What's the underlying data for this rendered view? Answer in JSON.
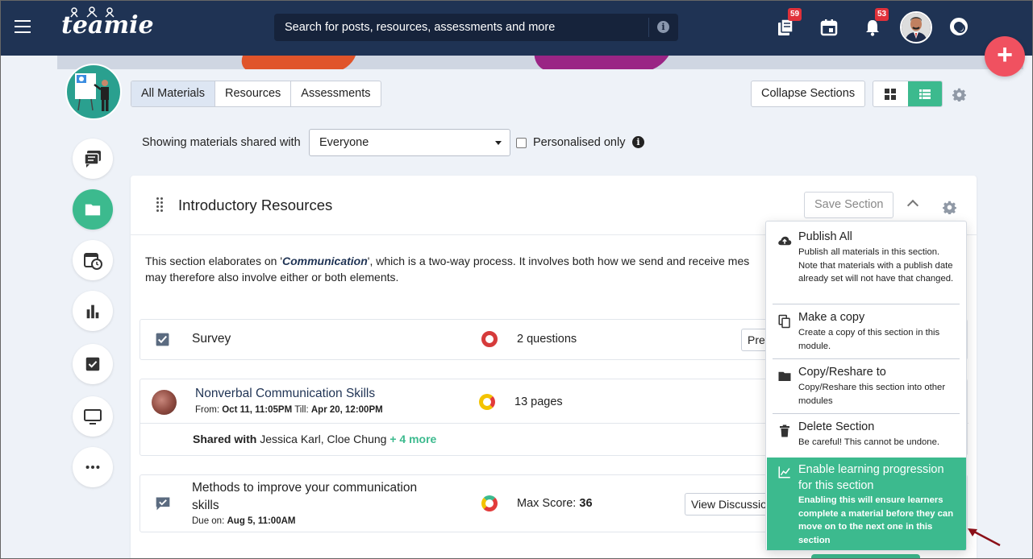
{
  "topbar": {
    "logo": "teamie",
    "search_placeholder": "Search for posts, resources, assessments and more",
    "library_badge": "59",
    "notifications_badge": "53"
  },
  "tabs": [
    "All Materials",
    "Resources",
    "Assessments"
  ],
  "toolbar": {
    "collapse_label": "Collapse Sections"
  },
  "filter": {
    "label": "Showing materials shared with",
    "selected": "Everyone",
    "personalised_label": "Personalised only"
  },
  "section": {
    "title": "Introductory Resources",
    "save_label": "Save Section",
    "desc_pre": "This section elaborates on '",
    "desc_em": "Communication",
    "desc_post": "', which is a two-way process. It involves both how we send and receive mes",
    "desc_line2": "may therefore also involve either or both elements."
  },
  "items": [
    {
      "title": "Survey",
      "meta": "2 questions",
      "button": "Preview"
    },
    {
      "title": "Nonverbal Communication Skills",
      "meta": "13 pages",
      "from_label": "From:",
      "from": "Oct 11, 11:05PM",
      "till_label": "Till:",
      "till": "Apr 20, 12:00PM",
      "shared_label": "Shared with",
      "shared_names": "Jessica Karl, Cloe Chung",
      "shared_more": "+ 4 more"
    },
    {
      "title_line1": "Methods to improve your communication",
      "title_line2": "skills",
      "due_label": "Due on:",
      "due": "Aug 5, 11:00AM",
      "meta_label": "Max Score:",
      "meta_value": "36",
      "button": "View Discussion"
    }
  ],
  "menu": {
    "publish": {
      "title": "Publish All",
      "desc": "Publish all materials in this section. Note that materials with a publish date already set will not have that changed."
    },
    "copy": {
      "title": "Make a copy",
      "desc": "Create a copy of this section in this module."
    },
    "reshare": {
      "title": "Copy/Reshare to",
      "desc": "Copy/Reshare this section into other modules"
    },
    "delete": {
      "title": "Delete Section",
      "desc": "Be careful! This cannot be undone."
    },
    "progression": {
      "title": "Enable learning progression for this section",
      "desc": "Enabling this will ensure learners complete a material before they can move on to the next one in this section"
    }
  },
  "colors": {
    "navy": "#1f3354",
    "green": "#3cba8e",
    "red": "#e0313a",
    "fab": "#f05160"
  }
}
